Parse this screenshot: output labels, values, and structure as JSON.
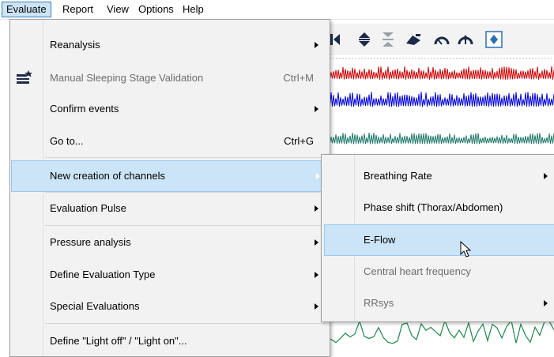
{
  "menubar": {
    "items": [
      {
        "label": "Evaluate",
        "active": true
      },
      {
        "label": "Report"
      },
      {
        "label": "View"
      },
      {
        "label": "Options"
      },
      {
        "label": "Help"
      }
    ]
  },
  "evaluate_menu": {
    "items": [
      {
        "label": "Reanalysis",
        "submenu": true
      },
      {
        "label": "Manual Sleeping Stage Validation",
        "shortcut": "Ctrl+M",
        "disabled": true,
        "icon": "stage-validation-icon"
      },
      {
        "label": "Confirm events",
        "submenu": true
      },
      {
        "label": "Go to...",
        "shortcut": "Ctrl+G"
      },
      {
        "label": "New creation of channels",
        "submenu": true,
        "highlighted": true
      },
      {
        "label": "Evaluation Pulse",
        "submenu": true
      },
      {
        "label": "Pressure analysis",
        "submenu": true
      },
      {
        "label": "Define Evaluation Type",
        "submenu": true
      },
      {
        "label": "Special Evaluations",
        "submenu": true
      },
      {
        "label": "Define \"Light off\" / \"Light on\"..."
      }
    ]
  },
  "channels_submenu": {
    "items": [
      {
        "label": "Breathing Rate",
        "submenu": true
      },
      {
        "label": "Phase shift (Thorax/Abdomen)"
      },
      {
        "label": "E-Flow",
        "highlighted": true
      },
      {
        "label": "Central heart frequency",
        "disabled": true
      },
      {
        "label": "RRsys",
        "submenu": true,
        "disabled": true
      }
    ]
  },
  "toolbar_icons": [
    "skip-back-icon",
    "expand-vertical-icon",
    "compress-vertical-icon",
    "satellite-icon",
    "gauge-down-icon",
    "gauge-up-icon",
    "network-icon"
  ],
  "colors": {
    "highlight_bg": "#cce4f7",
    "highlight_border": "#99c9ef",
    "menu_bg": "#f2f2f2",
    "wave_red": "#d40000",
    "wave_blue": "#0000e0",
    "wave_teal": "#1f7a6a",
    "wave_green": "#1a8a4a"
  }
}
